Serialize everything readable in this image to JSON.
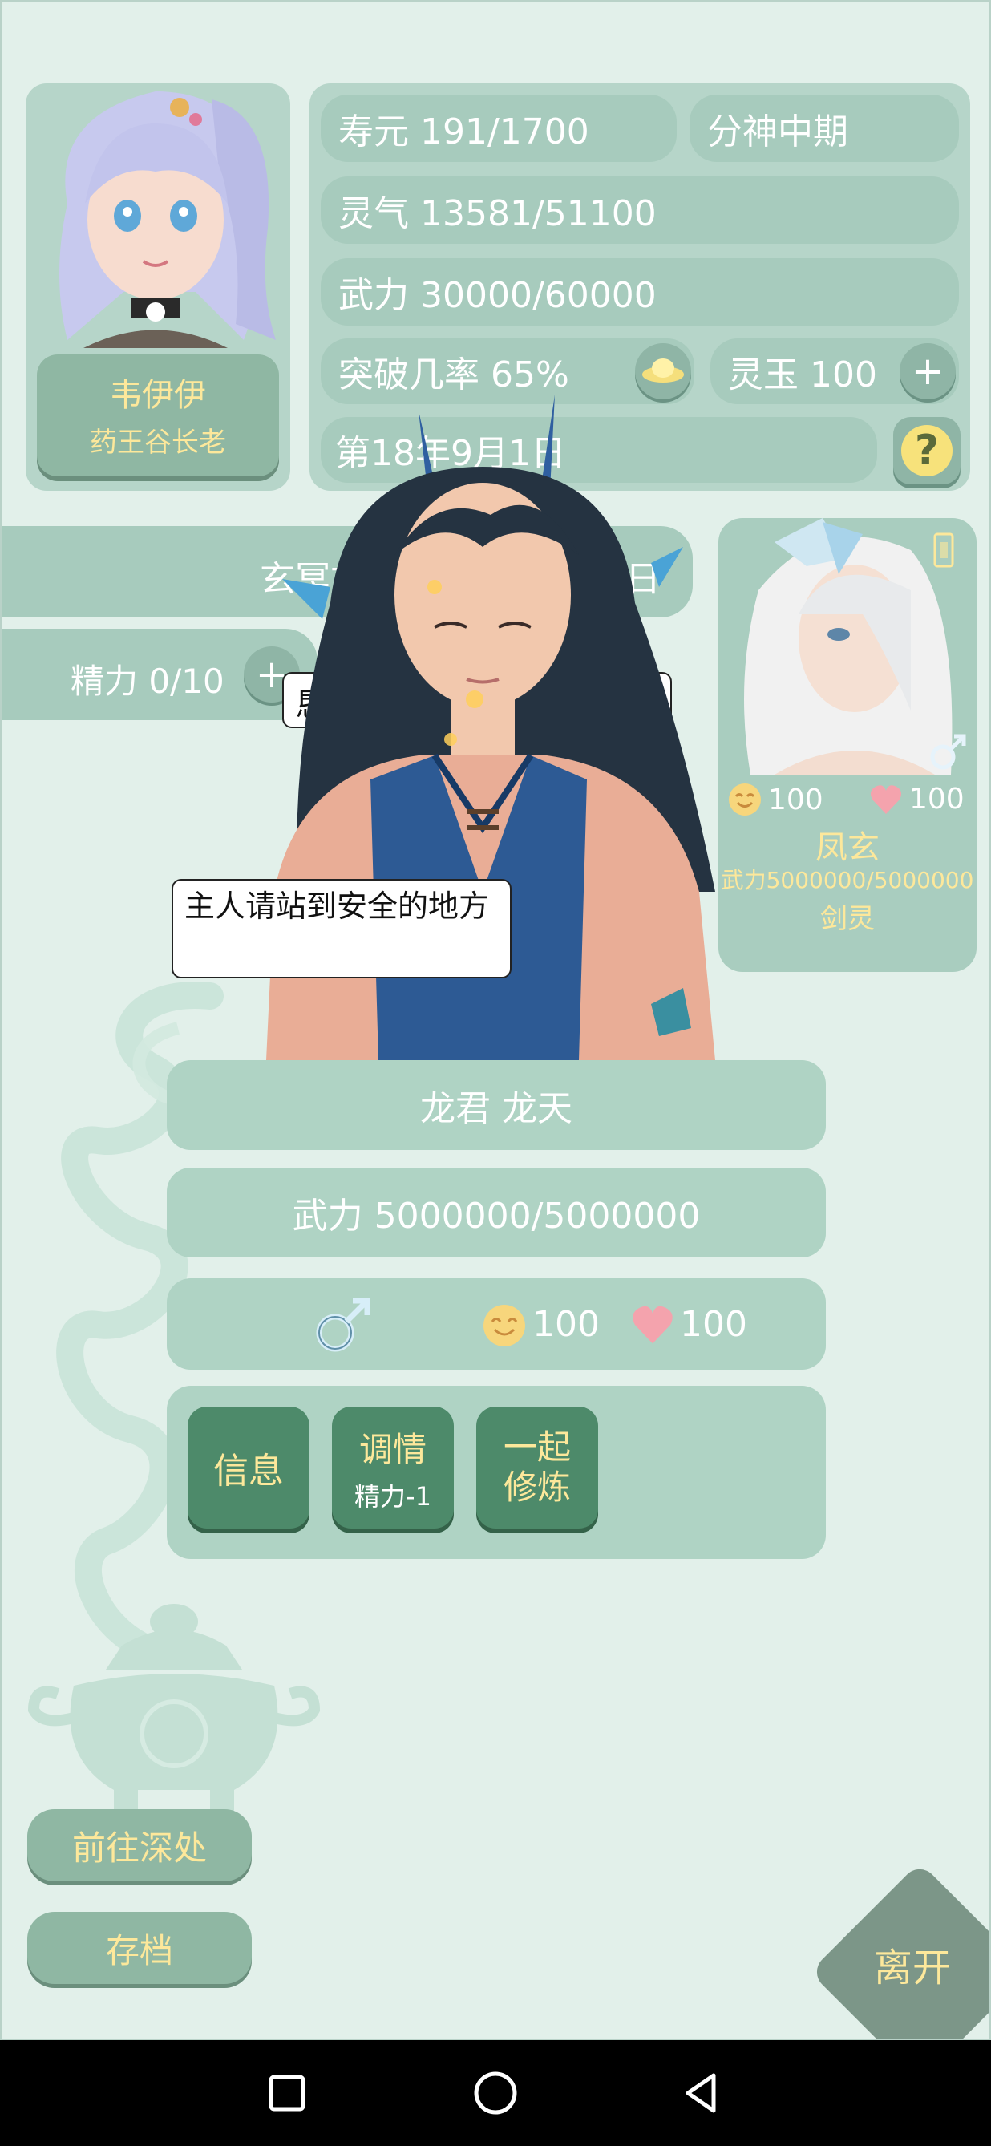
{
  "player": {
    "name": "韦伊伊",
    "title": "药王谷长老"
  },
  "stats": {
    "lifespan": "寿元 191/1700",
    "realm": "分神中期",
    "spirit": "灵气 13581/51100",
    "force": "武力 30000/60000",
    "breakthrough": "突破几率 65%",
    "jade": "灵玉 100",
    "date": "第18年9月1日",
    "help": "?"
  },
  "location": {
    "label_left": "玄冥古窟",
    "label_right": "0日"
  },
  "energy": {
    "label": "精力 0/10",
    "plus": "+"
  },
  "companion": {
    "mood": "100",
    "affection": "100",
    "name": "凤玄",
    "force": "武力5000000/5000000",
    "role": "剑灵"
  },
  "hint_bubble": {
    "partial": "恳为"
  },
  "speech_bubble": {
    "text": "主人请站到安全的地方"
  },
  "character": {
    "name": "龙君 龙天",
    "force": "武力 5000000/5000000",
    "mood": "100",
    "affection": "100",
    "actions": [
      {
        "label": "信息",
        "sub": ""
      },
      {
        "label": "调情",
        "sub": "精力-1"
      },
      {
        "label": "一起修炼",
        "sub": ""
      }
    ]
  },
  "bottom": {
    "go_deeper": "前往深处",
    "save": "存档",
    "leave": "离开"
  },
  "colors": {
    "background": "#e2f0ea",
    "pill": "#a7cbbd",
    "action_button": "#4d8a6a",
    "gold_text": "#fde89b",
    "pink_heart": "#f4a3ad"
  }
}
